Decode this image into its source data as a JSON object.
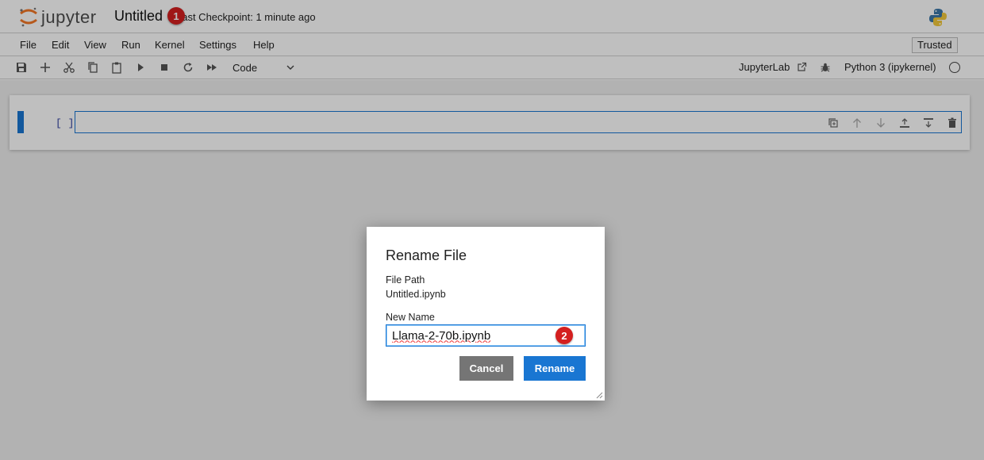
{
  "header": {
    "logo_text": "jupyter",
    "notebook_title": "Untitled",
    "checkpoint_text": "Last Checkpoint: 1 minute ago"
  },
  "menu": {
    "items": [
      "File",
      "Edit",
      "View",
      "Run",
      "Kernel",
      "Settings",
      "Help"
    ],
    "trusted_label": "Trusted"
  },
  "toolbar": {
    "icons": [
      "save-icon",
      "add-cell-icon",
      "cut-icon",
      "copy-icon",
      "paste-icon",
      "run-icon",
      "stop-icon",
      "restart-icon",
      "fast-forward-icon"
    ],
    "cell_type": "Code",
    "jupyterlab_link": "JupyterLab",
    "kernel_name": "Python 3 (ipykernel)"
  },
  "cell": {
    "prompt": "[ ]:",
    "input_value": ""
  },
  "dialog": {
    "title": "Rename File",
    "file_path_label": "File Path",
    "file_path_value": "Untitled.ipynb",
    "new_name_label": "New Name",
    "new_name_value": "Llama-2-70b.ipynb",
    "cancel_label": "Cancel",
    "rename_label": "Rename"
  },
  "annotations": {
    "step1": "1",
    "step2": "2"
  },
  "colors": {
    "accent": "#1976d2",
    "badge": "#d41f1f",
    "cancel": "#757575"
  }
}
